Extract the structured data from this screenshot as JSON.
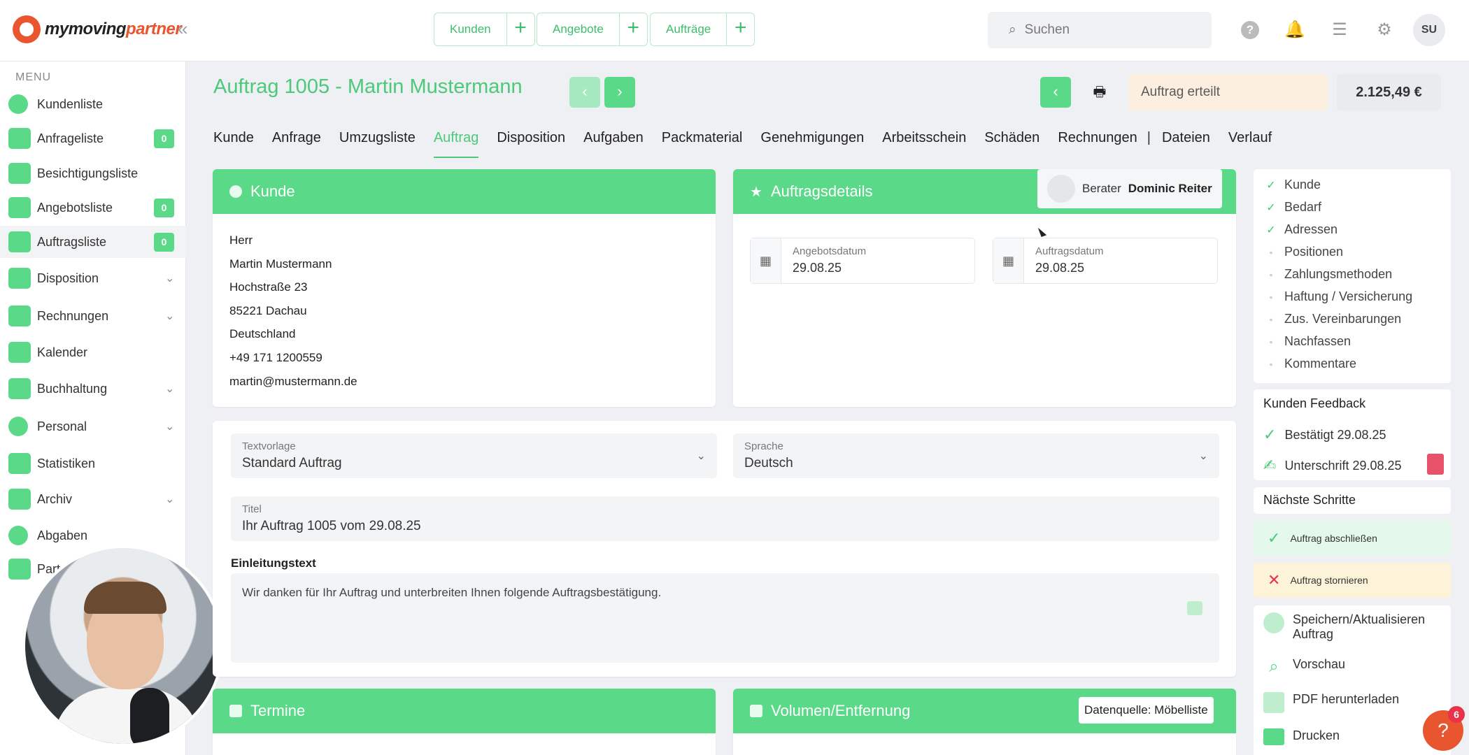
{
  "brand": {
    "name_part1": "mymoving",
    "name_part2": "partner",
    "accent": "#e8552f"
  },
  "colors": {
    "primary": "#5ad988",
    "primary_text": "#4cc97a",
    "status_bg": "#fdefdf",
    "danger": "#e8334a"
  },
  "topbar": {
    "collapse_icon": "double-chevron-left-icon",
    "quick_links": [
      {
        "label": "Kunden",
        "plus": "+"
      },
      {
        "label": "Angebote",
        "plus": "+"
      },
      {
        "label": "Aufträge",
        "plus": "+"
      }
    ],
    "search_placeholder": "Suchen",
    "avatar_initials": "SU"
  },
  "sidebar": {
    "menu_label": "MENU",
    "items": [
      {
        "label": "Kundenliste"
      },
      {
        "label": "Anfrageliste",
        "badge": "0"
      },
      {
        "label": "Besichtigungsliste"
      },
      {
        "label": "Angebotsliste",
        "badge": "0"
      },
      {
        "label": "Auftragsliste",
        "badge": "0"
      },
      {
        "label": "Disposition",
        "chevron": "⌄"
      },
      {
        "label": "Rechnungen",
        "chevron": "⌄"
      },
      {
        "label": "Kalender"
      },
      {
        "label": "Buchhaltung",
        "chevron": "⌄"
      },
      {
        "label": "Personal",
        "chevron": "⌄"
      },
      {
        "label": "Statistiken"
      },
      {
        "label": "Archiv",
        "chevron": "⌄"
      },
      {
        "label": "Abgaben"
      },
      {
        "label": "Part"
      }
    ]
  },
  "page": {
    "title": "Auftrag 1005 - Martin Mustermann",
    "status": "Auftrag erteilt",
    "price": "2.125,49 €"
  },
  "tabs": [
    "Kunde",
    "Anfrage",
    "Umzugsliste",
    "Auftrag",
    "Disposition",
    "Aufgaben",
    "Packmaterial",
    "Genehmigungen",
    "Arbeitsschein",
    "Schäden",
    "Rechnungen",
    "|",
    "Dateien",
    "Verlauf"
  ],
  "customer_card": {
    "title": "Kunde",
    "lines": [
      "Herr",
      "Martin Mustermann",
      "Hochstraße 23",
      "85221 Dachau",
      "Deutschland",
      "+49 171 1200559",
      "martin@mustermann.de"
    ]
  },
  "details_card": {
    "title": "Auftragsdetails",
    "berater_label": "Berater",
    "berater_name": "Dominic Reiter",
    "offer_date_label": "Angebotsdatum",
    "offer_date": "29.08.25",
    "order_date_label": "Auftragsdatum",
    "order_date": "29.08.25"
  },
  "form": {
    "template_label": "Textvorlage",
    "template_value": "Standard Auftrag",
    "language_label": "Sprache",
    "language_value": "Deutsch",
    "title_label": "Titel",
    "title_value": "Ihr Auftrag 1005 vom 29.08.25",
    "intro_label": "Einleitungstext",
    "intro_value": "Wir danken für Ihr Auftrag und unterbreiten Ihnen folgende Auftragsbestätigung."
  },
  "bottom_cards": {
    "termine_title": "Termine",
    "volume_title": "Volumen/Entfernung",
    "volume_source": "Datenquelle: Möbelliste"
  },
  "checklist": [
    {
      "label": "Kunde",
      "done": true
    },
    {
      "label": "Bedarf",
      "done": true
    },
    {
      "label": "Adressen",
      "done": true
    },
    {
      "label": "Positionen",
      "done": false
    },
    {
      "label": "Zahlungsmethoden",
      "done": false
    },
    {
      "label": "Haftung / Versicherung",
      "done": false
    },
    {
      "label": "Zus. Vereinbarungen",
      "done": false
    },
    {
      "label": "Nachfassen",
      "done": false
    },
    {
      "label": "Kommentare",
      "done": false
    }
  ],
  "feedback": {
    "title": "Kunden Feedback",
    "confirmed": "Bestätigt 29.08.25",
    "signature": "Unterschrift 29.08.25"
  },
  "next_steps": {
    "title": "Nächste Schritte",
    "complete": "Auftrag abschließen",
    "cancel": "Auftrag stornieren"
  },
  "actions": {
    "save": "Speichern/Aktualisieren Auftrag",
    "preview": "Vorschau",
    "pdf": "PDF herunterladen",
    "print": "Drucken"
  },
  "help": {
    "label": "?",
    "badge": "6"
  }
}
